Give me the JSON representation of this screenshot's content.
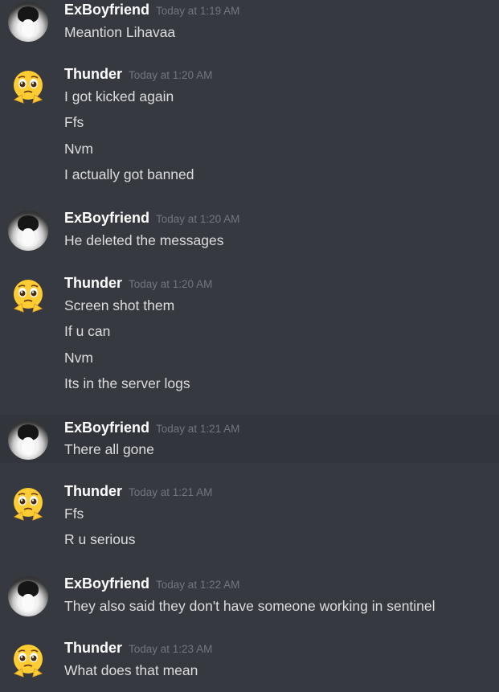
{
  "messages": [
    {
      "author": "ExBoyfriend",
      "avatar": "cat-avatar",
      "timestamp": "Today at 1:19 AM",
      "lines": [
        "Meantion Lihavaa"
      ]
    },
    {
      "author": "Thunder",
      "avatar": "pleading-face-emoji-avatar",
      "timestamp": "Today at 1:20 AM",
      "lines": [
        "I got kicked again",
        "Ffs",
        "Nvm",
        "I actually got banned"
      ]
    },
    {
      "author": "ExBoyfriend",
      "avatar": "cat-avatar",
      "timestamp": "Today at 1:20 AM",
      "lines": [
        "He deleted the messages"
      ]
    },
    {
      "author": "Thunder",
      "avatar": "pleading-face-emoji-avatar",
      "timestamp": "Today at 1:20 AM",
      "lines": [
        "Screen shot them",
        "If u can",
        "Nvm",
        "Its in the server logs"
      ]
    },
    {
      "author": "ExBoyfriend",
      "avatar": "cat-avatar",
      "timestamp": "Today at 1:21 AM",
      "lines": [
        "There all gone"
      ]
    },
    {
      "author": "Thunder",
      "avatar": "pleading-face-emoji-avatar",
      "timestamp": "Today at 1:21 AM",
      "lines": [
        "Ffs",
        "R u serious"
      ]
    },
    {
      "author": "ExBoyfriend",
      "avatar": "cat-avatar",
      "timestamp": "Today at 1:22 AM",
      "lines": [
        "They also said they don't have someone working in sentinel"
      ]
    },
    {
      "author": "Thunder",
      "avatar": "pleading-face-emoji-avatar",
      "timestamp": "Today at 1:23 AM",
      "lines": [
        "What does that mean"
      ]
    }
  ],
  "colors": {
    "background": "#36393f",
    "hover_background": "#32353b",
    "username": "#ffffff",
    "timestamp": "#72767d",
    "text": "#dcddde"
  }
}
